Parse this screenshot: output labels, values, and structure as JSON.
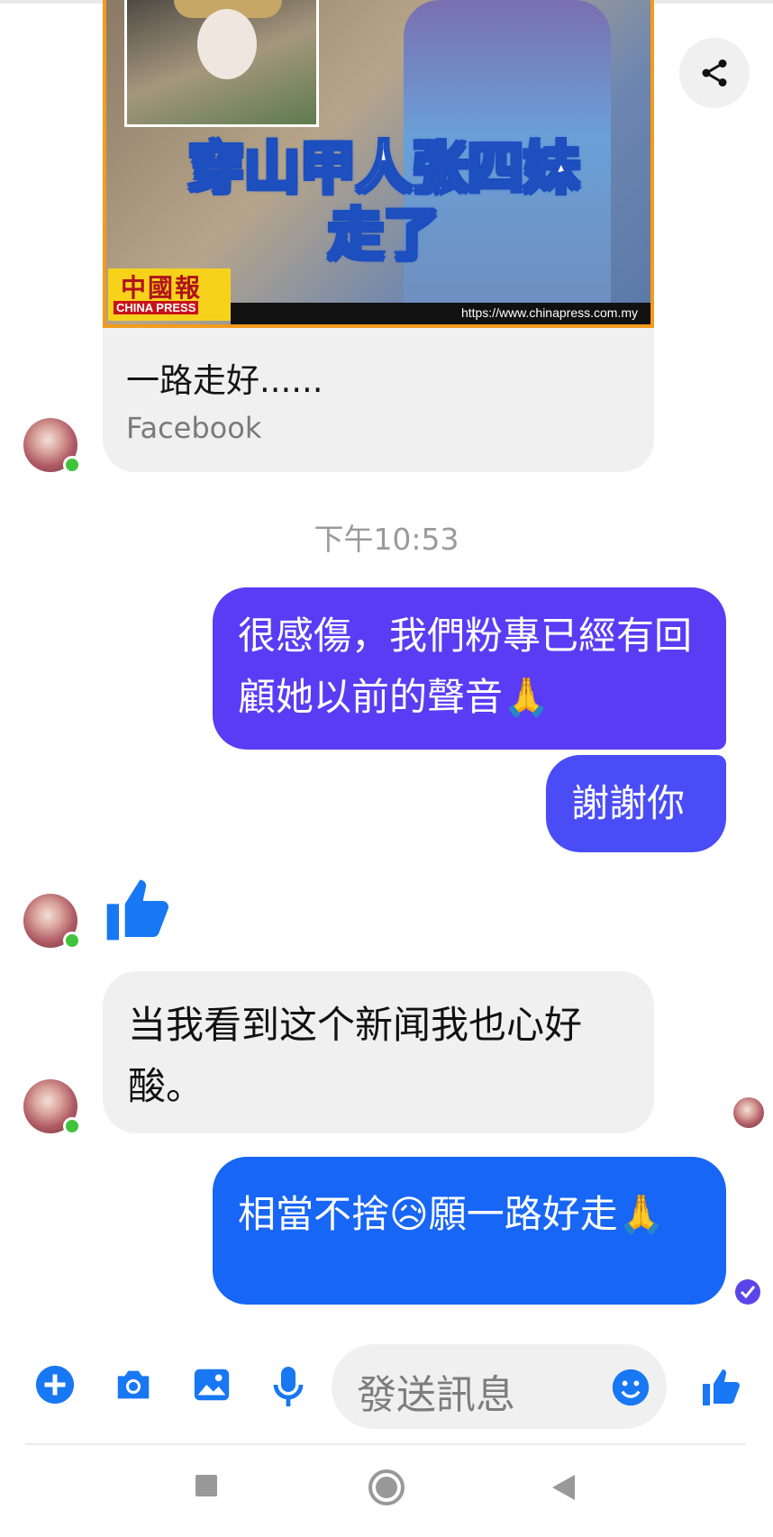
{
  "shared_post": {
    "headline": "穿山甲人张四妹\n走了",
    "logo_zh": "中國報",
    "logo_en": "CHINA PRESS",
    "image_url_text": "https://www.chinapress.com.my",
    "title": "一路走好......",
    "source": "Facebook"
  },
  "timestamp": "下午10:53",
  "messages": [
    {
      "direction": "out",
      "text": "很感傷，我們粉專已經有回顧她以前的聲音🙏"
    },
    {
      "direction": "out",
      "text": "謝謝你"
    },
    {
      "direction": "in",
      "text": "👍"
    },
    {
      "direction": "in",
      "text": "当我看到这个新闻我也心好酸。"
    },
    {
      "direction": "out",
      "text": "相當不捨😥願一路好走🙏"
    }
  ],
  "composer": {
    "placeholder": "發送訊息"
  },
  "icons": {
    "share": "share-icon",
    "add": "plus-icon",
    "camera": "camera-icon",
    "gallery": "image-icon",
    "mic": "microphone-icon",
    "emoji": "emoji-icon",
    "like": "thumbs-up-icon",
    "seen": "seen-check-icon"
  },
  "colors": {
    "outgoing_1": "#5a3cf5",
    "outgoing_2": "#4a4cf6",
    "outgoing_3": "#1766f6",
    "incoming": "#f0f0f0",
    "accent": "#1877f2",
    "online": "#41c33b"
  }
}
